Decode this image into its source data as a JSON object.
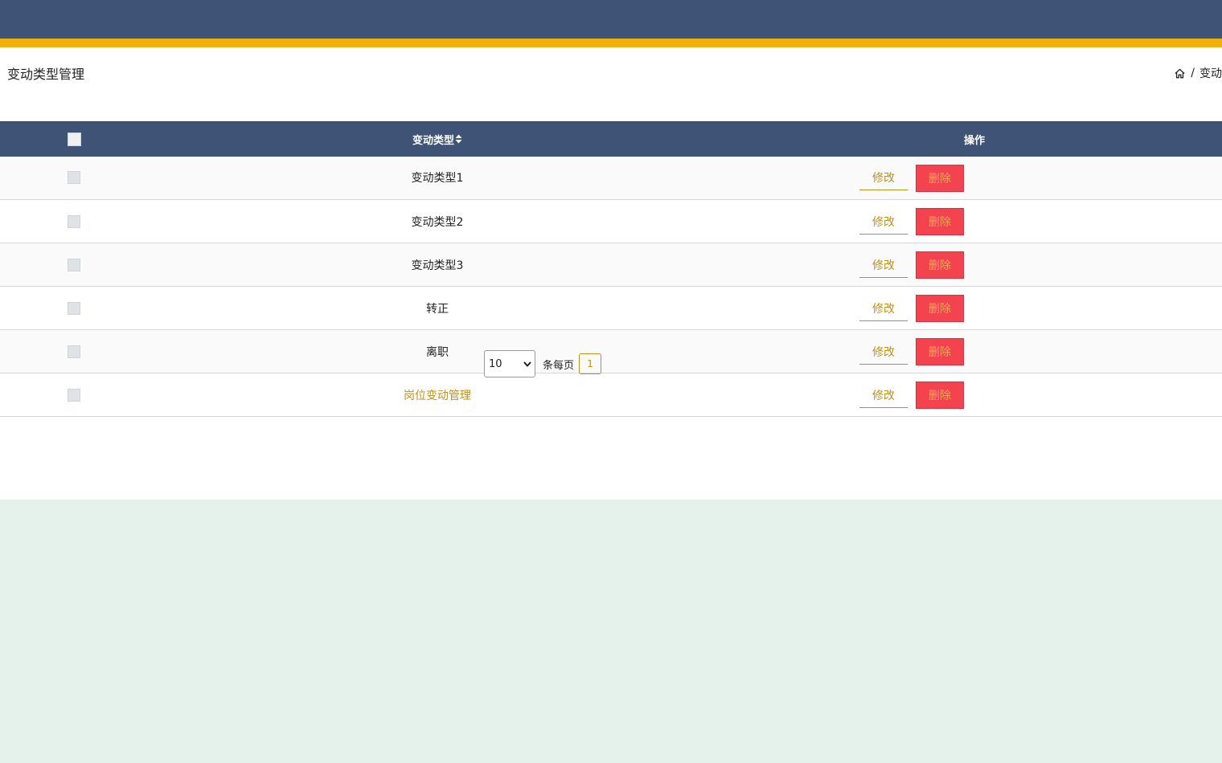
{
  "page": {
    "title": "变动类型管理",
    "breadcrumb": {
      "home_icon": "home-icon",
      "separator": "/",
      "current": "变动"
    }
  },
  "colors": {
    "topbar": "#3e5375",
    "accent_stripe": "#f0b10e",
    "link": "#c0901b",
    "delete_bg": "#f2434f",
    "background": "#e5f2ec"
  },
  "table": {
    "headers": {
      "select_all": "",
      "type": "变动类型",
      "sort_icon": "sort-icon",
      "actions": "操作"
    },
    "rows": [
      {
        "type": "变动类型1",
        "edit": "修改",
        "delete": "删除"
      },
      {
        "type": "变动类型2",
        "edit": "修改",
        "delete": "删除"
      },
      {
        "type": "变动类型3",
        "edit": "修改",
        "delete": "删除"
      },
      {
        "type": "转正",
        "edit": "修改",
        "delete": "删除"
      },
      {
        "type": "离职",
        "edit": "修改",
        "delete": "删除"
      },
      {
        "type": "岗位变动管理",
        "edit": "修改",
        "delete": "删除"
      }
    ]
  },
  "pagination": {
    "page_size": "10",
    "per_page_label": "条每页",
    "current_page": "1"
  }
}
